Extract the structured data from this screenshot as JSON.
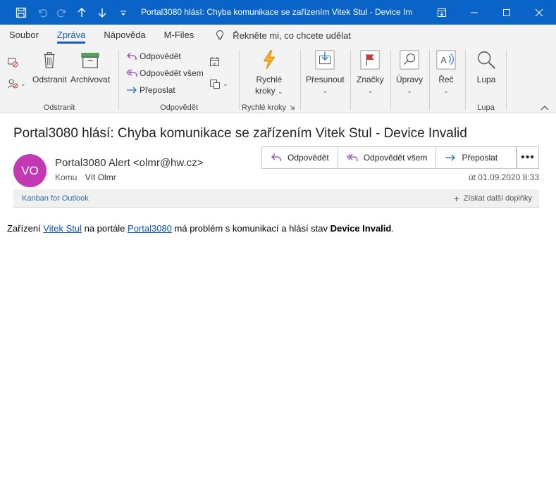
{
  "window": {
    "title": "Portal3080 hlásí: Chyba komunikace se zařízením Vitek Stul - Device Inv..."
  },
  "ribbon_tabs": [
    "Soubor",
    "Zpráva",
    "Nápověda",
    "M-Files"
  ],
  "tell_me": "Řekněte mi, co chcete udělat",
  "groups": {
    "delete": {
      "label": "Odstranit",
      "delete_button": "Odstranit",
      "archive_button": "Archivovat"
    },
    "respond": {
      "label": "Odpovědět",
      "reply": "Odpovědět",
      "reply_all": "Odpovědět všem",
      "forward": "Přeposlat"
    },
    "quick_steps": {
      "label": "Rychlé kroky",
      "button_line1": "Rychlé",
      "button_line2": "kroky"
    },
    "move": {
      "button": "Přesunout"
    },
    "tags": {
      "button": "Značky"
    },
    "editing": {
      "button": "Úpravy"
    },
    "speech": {
      "button": "Řeč"
    },
    "zoom": {
      "label": "Lupa",
      "button": "Lupa"
    }
  },
  "message": {
    "subject": "Portal3080 hlásí: Chyba komunikace se zařízením Vitek Stul - Device Invalid",
    "avatar_initials": "VO",
    "avatar_color": "#c239b3",
    "sender": "Portal3080 Alert <olmr@hw.cz>",
    "to_label": "Komu",
    "to_name": "Vít Olmr",
    "date": "út 01.09.2020 8:33",
    "actions": {
      "reply": "Odpovědět",
      "reply_all": "Odpovědět všem",
      "forward": "Přeposlat"
    },
    "addin_link": "Kanban for Outlook",
    "addin_more": "Získat další doplňky",
    "body": {
      "part1": "Zařízení ",
      "link1": "Vitek Stul",
      "part2": " na portále ",
      "link2": "Portal3080",
      "part3": " má problém s komunikací a hlásí stav ",
      "bold": "Device Invalid",
      "part4": "."
    }
  }
}
